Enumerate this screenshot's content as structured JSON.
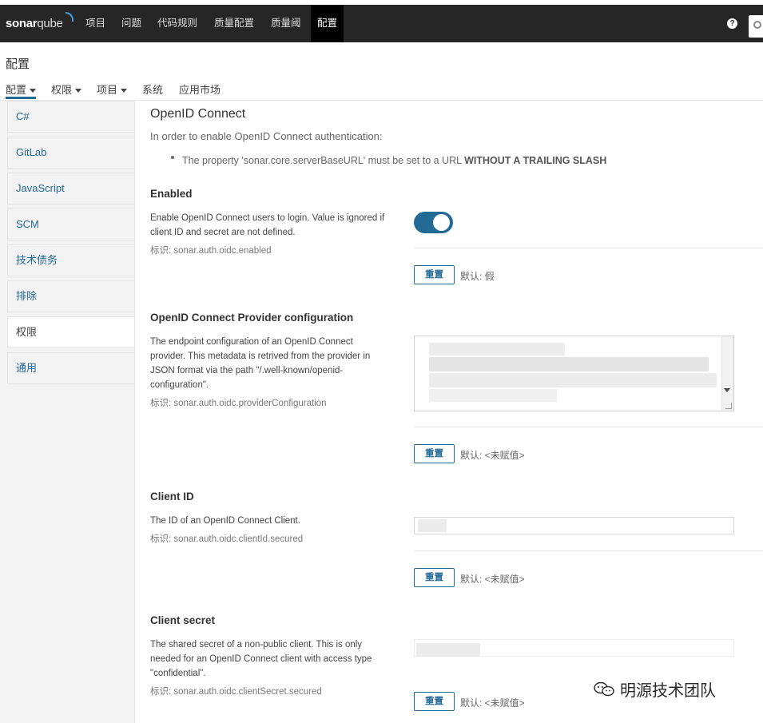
{
  "topnav": {
    "logo_bold": "sonar",
    "logo_light": "qube",
    "items": [
      "项目",
      "问题",
      "代码规则",
      "质量配置",
      "质量阈",
      "配置"
    ],
    "help_glyph": "?"
  },
  "page": {
    "title": "配置",
    "tabs": [
      "配置",
      "权限",
      "项目",
      "系统",
      "应用市场"
    ]
  },
  "sidebar": {
    "items": [
      "C#",
      "GitLab",
      "JavaScript",
      "SCM",
      "技术债务",
      "排除",
      "权限",
      "通用"
    ],
    "active": "权限"
  },
  "section": {
    "title": "OpenID Connect",
    "description": "In order to enable OpenID Connect authentication:",
    "note_prefix": "The property 'sonar.core.serverBaseURL' must be set to a URL ",
    "note_bold": "WITHOUT A TRAILING SLASH"
  },
  "settings": [
    {
      "title": "Enabled",
      "description": "Enable OpenID Connect users to login. Value is ignored if client ID and secret are not defined.",
      "key": "标识: sonar.auth.oidc.enabled",
      "toggle_on": true,
      "reset_label": "重置",
      "default_text": "默认: 假"
    },
    {
      "title": "OpenID Connect Provider configuration",
      "description": "The endpoint configuration of an OpenID Connect provider. This metadata is retrived from the provider in JSON format via the path \"/.well-known/openid-configuration\".",
      "key": "标识: sonar.auth.oidc.providerConfiguration",
      "reset_label": "重置",
      "default_text": "默认: <未赋值>"
    },
    {
      "title": "Client ID",
      "description": "The ID of an OpenID Connect Client.",
      "key": "标识: sonar.auth.oidc.clientId.secured",
      "reset_label": "重置",
      "default_text": "默认: <未赋值>"
    },
    {
      "title": "Client secret",
      "description": "The shared secret of a non-public client. This is only needed for an OpenID Connect client with access type \"confidential\".",
      "key": "标识: sonar.auth.oidc.clientSecret.secured",
      "reset_label": "重置",
      "default_text": "默认: <未赋值>"
    }
  ],
  "watermark": "明源技术团队",
  "colors": {
    "topbar": "#262626",
    "accent": "#236a97",
    "sidebar_bg": "#f3f3f3"
  }
}
